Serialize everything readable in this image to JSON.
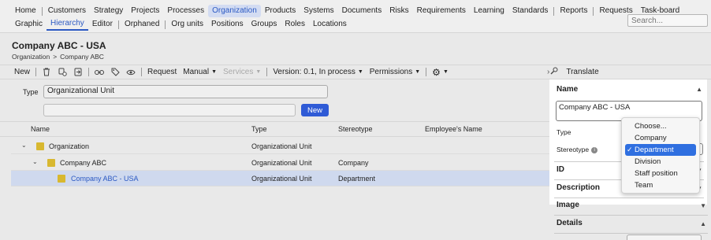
{
  "nav": {
    "row1": [
      "Home",
      "Customers",
      "Strategy",
      "Projects",
      "Processes",
      "Organization",
      "Products",
      "Systems",
      "Documents",
      "Risks",
      "Requirements",
      "Learning",
      "Standards",
      "Reports",
      "Requests",
      "Task-board"
    ],
    "row1_active": "Organization",
    "row2": [
      "Graphic",
      "Hierarchy",
      "Editor",
      "Orphaned",
      "Org units",
      "Positions",
      "Groups",
      "Roles",
      "Locations"
    ],
    "row2_active": "Hierarchy",
    "search_placeholder": "Search..."
  },
  "header": {
    "title": "Company ABC - USA",
    "breadcrumb": [
      "Organization",
      ">",
      "Company ABC"
    ]
  },
  "toolbar": {
    "new_label": "New",
    "request_label": "Request",
    "manual_label": "Manual",
    "services_label": "Services",
    "version_label": "Version: 0.1, In process",
    "permissions_label": "Permissions",
    "icons": [
      "trash-icon",
      "copy-icon",
      "move-icon",
      "link-icon",
      "tag-icon",
      "eye-icon",
      "gear-icon"
    ]
  },
  "filter": {
    "type_label": "Type",
    "type_value": "Organizational Unit",
    "new_button": "New"
  },
  "table": {
    "columns": [
      "Name",
      "Type",
      "Stereotype",
      "Employee's Name"
    ],
    "rows": [
      {
        "name": "Organization",
        "type": "Organizational Unit",
        "stereotype": ""
      },
      {
        "name": "Company ABC",
        "type": "Organizational Unit",
        "stereotype": "Company"
      },
      {
        "name": "Company ABC - USA",
        "type": "Organizational Unit",
        "stereotype": "Department"
      }
    ]
  },
  "panel": {
    "translate_label": "Translate",
    "name_section": "Name",
    "name_value": "Company ABC - USA",
    "type_label": "Type",
    "stereotype_label": "Stereotype",
    "id_section": "ID",
    "description_section": "Description",
    "image_section": "Image",
    "details_section": "Details"
  },
  "dropdown": {
    "options": [
      "Choose...",
      "Company",
      "Department",
      "Division",
      "Staff position",
      "Team"
    ],
    "selected": "Department"
  },
  "colors": {
    "accent": "#2b59c3",
    "selected_row": "#cfd9ee",
    "folder": "#d8b830",
    "button": "#2f5bd6"
  }
}
